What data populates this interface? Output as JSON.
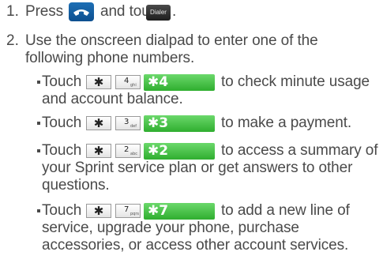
{
  "steps": [
    {
      "number": "1.",
      "text_before": "Press",
      "text_between": "and touch",
      "text_after": ".",
      "phone_icon": "phone-handset-icon",
      "dialer_label": "Dialer"
    },
    {
      "number": "2.",
      "lines": [
        "Use the onscreen dialpad to enter one of the",
        "following phone numbers."
      ]
    }
  ],
  "bullets": [
    {
      "touch": "Touch",
      "star": "✱",
      "digit": "4",
      "letters": "ghi",
      "combo": "✱4",
      "lines": [
        "to check minute usage",
        "and account balance."
      ]
    },
    {
      "touch": "Touch",
      "star": "✱",
      "digit": "3",
      "letters": "def",
      "combo": "✱3",
      "lines": [
        "to make a payment."
      ]
    },
    {
      "touch": "Touch",
      "star": "✱",
      "digit": "2",
      "letters": "abc",
      "combo": "✱2",
      "lines": [
        "to access a summary of",
        "your Sprint service plan or get answers to other",
        "questions."
      ]
    },
    {
      "touch": "Touch",
      "star": "✱",
      "digit": "7",
      "letters": "pqrs",
      "combo": "✱7",
      "lines": [
        "to add a new line of",
        "service, upgrade your phone, purchase",
        "accessories, or access other account services."
      ]
    }
  ],
  "colors": {
    "text": "#4a4a4a",
    "combo_green": "#3cb83c",
    "phone_blue": "#1d6fb5"
  }
}
